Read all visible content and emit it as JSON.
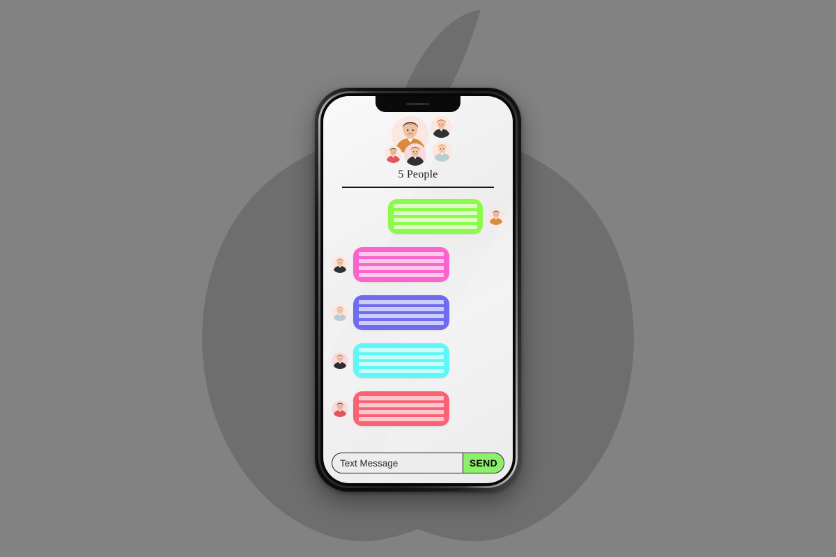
{
  "background": {
    "color": "#828282",
    "logo_name": "apple-logo-watermark",
    "logo_color": "#6e6e6e"
  },
  "device": {
    "name": "iphone-x-mockup",
    "frame_color": "#111111",
    "screen_bg": "#f0f0f1",
    "notch_label": "notch"
  },
  "header": {
    "people_label": "5 People",
    "avatars": [
      {
        "name": "group-avatar-main",
        "hair": "#3f3a42",
        "top": "#d98a3d",
        "skin": "#f0c0a0",
        "ring": "#fae7e0"
      },
      {
        "name": "group-avatar-top-right",
        "hair": "#e2662c",
        "top": "#2f3136",
        "skin": "#f3c5a5",
        "ring": "#fae7e0"
      },
      {
        "name": "group-avatar-right",
        "hair": "#f0a25c",
        "top": "#b8ccd2",
        "skin": "#f5cdae",
        "ring": "#fae7e0"
      },
      {
        "name": "group-avatar-bottom-left",
        "hair": "#3f3a42",
        "top": "#e0565a",
        "skin": "#f0c0a0",
        "ring": "#fae7e0"
      },
      {
        "name": "group-avatar-bottom",
        "hair": "#d9542a",
        "top": "#2f3136",
        "skin": "#f3c5a5",
        "ring": "#f8dbe0"
      }
    ]
  },
  "messages": [
    {
      "name": "message-outgoing-green",
      "direction": "out",
      "bubble_color": "#8cfa48",
      "line_color": "#ddfbc9",
      "lines": 4,
      "avatar": {
        "name": "message-avatar-self",
        "hair": "#3f3a42",
        "top": "#d98a3d",
        "skin": "#f0c0a0",
        "ring": "#fae7e0"
      }
    },
    {
      "name": "message-incoming-pink",
      "direction": "in",
      "bubble_color": "#fb63cd",
      "line_color": "#fdc8ea",
      "lines": 4,
      "avatar": {
        "name": "message-avatar-ginger-beard",
        "hair": "#e2662c",
        "top": "#2f3136",
        "skin": "#f3c5a5",
        "ring": "#fae7e0"
      }
    },
    {
      "name": "message-incoming-purple",
      "direction": "in",
      "bubble_color": "#6f6cf2",
      "line_color": "#cdcdfa",
      "lines": 4,
      "avatar": {
        "name": "message-avatar-blond",
        "hair": "#f0a25c",
        "top": "#b8ccd2",
        "skin": "#f5cdae",
        "ring": "#fae7e0"
      }
    },
    {
      "name": "message-incoming-cyan",
      "direction": "in",
      "bubble_color": "#5ef6f6",
      "line_color": "#c9fbfb",
      "lines": 4,
      "avatar": {
        "name": "message-avatar-redhead",
        "hair": "#e2662c",
        "top": "#2b2b30",
        "skin": "#f3c5a5",
        "ring": "#f8dbe0"
      }
    },
    {
      "name": "message-incoming-red",
      "direction": "in",
      "bubble_color": "#fb6274",
      "line_color": "#fcc8cf",
      "lines": 4,
      "avatar": {
        "name": "message-avatar-dark-hair-red-top",
        "hair": "#2f2b33",
        "top": "#e0565a",
        "skin": "#f0c0a0",
        "ring": "#f8dbe0"
      }
    }
  ],
  "composer": {
    "placeholder": "Text Message",
    "value": "",
    "send_label": "SEND",
    "send_color": "#8df06a"
  }
}
